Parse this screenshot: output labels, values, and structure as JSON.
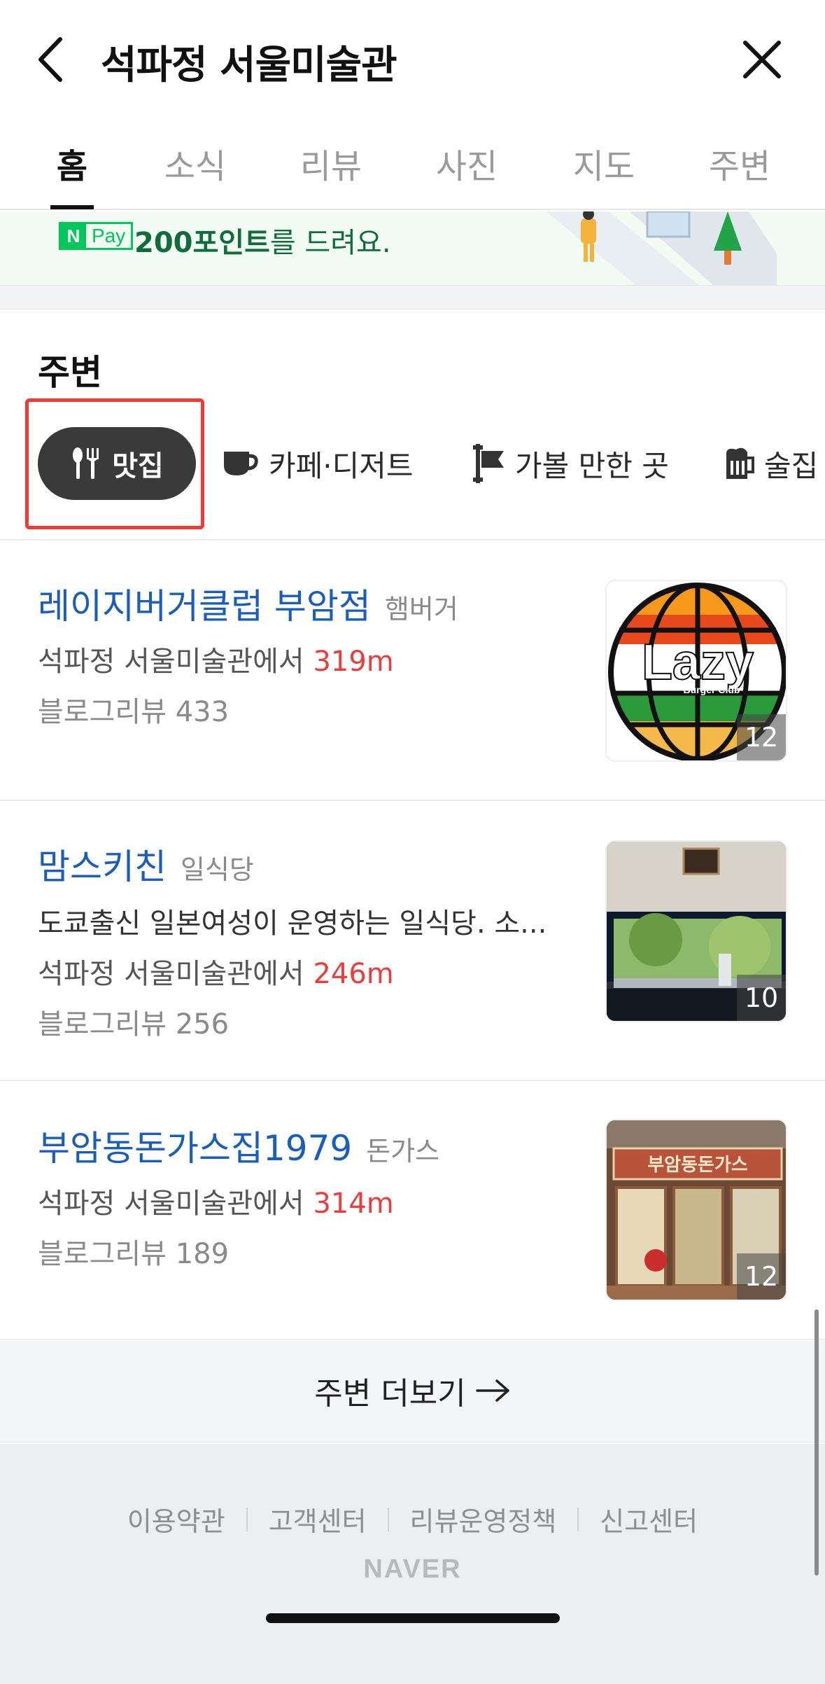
{
  "header": {
    "title": "석파정 서울미술관"
  },
  "tabs": [
    {
      "label": "홈",
      "active": true
    },
    {
      "label": "소식",
      "active": false
    },
    {
      "label": "리뷰",
      "active": false
    },
    {
      "label": "사진",
      "active": false
    },
    {
      "label": "지도",
      "active": false
    },
    {
      "label": "주변",
      "active": false
    }
  ],
  "banner": {
    "npay_n": "N",
    "npay_label": "Pay",
    "points": "200포인트",
    "text_rest": "를 드려요."
  },
  "nearby": {
    "title": "주변",
    "chips": [
      {
        "label": "맛집",
        "icon": "fork-knife-icon",
        "active": true
      },
      {
        "label": "카페·디저트",
        "icon": "coffee-cup-icon",
        "active": false
      },
      {
        "label": "가볼 만한 곳",
        "icon": "flag-icon",
        "active": false
      },
      {
        "label": "술집",
        "icon": "beer-mug-icon",
        "active": false
      }
    ],
    "items": [
      {
        "name": "레이지버거클럽 부암점",
        "category": "햄버거",
        "distance_prefix": "석파정 서울미술관에서",
        "distance": "319m",
        "review": "블로그리뷰 433",
        "photo_count": "12",
        "thumb_text": "Lazy",
        "thumb_subtext": "Burger Club"
      },
      {
        "name": "맘스키친",
        "category": "일식당",
        "description": "도쿄출신 일본여성이 운영하는 일식당. 소...",
        "distance_prefix": "석파정 서울미술관에서",
        "distance": "246m",
        "review": "블로그리뷰 256",
        "photo_count": "10"
      },
      {
        "name": "부암동돈가스집1979",
        "category": "돈가스",
        "distance_prefix": "석파정 서울미술관에서",
        "distance": "314m",
        "review": "블로그리뷰 189",
        "photo_count": "12",
        "thumb_sign": "부암동돈가스"
      }
    ],
    "more_label": "주변 더보기"
  },
  "footer": {
    "links": [
      "이용약관",
      "고객센터",
      "리뷰운영정책",
      "신고센터"
    ],
    "logo": "NAVER"
  },
  "colors": {
    "link_blue": "#1a5dbb",
    "distance_red": "#ec3c3c",
    "naver_green": "#03c75a",
    "annotation_red": "#ef3a3a"
  }
}
